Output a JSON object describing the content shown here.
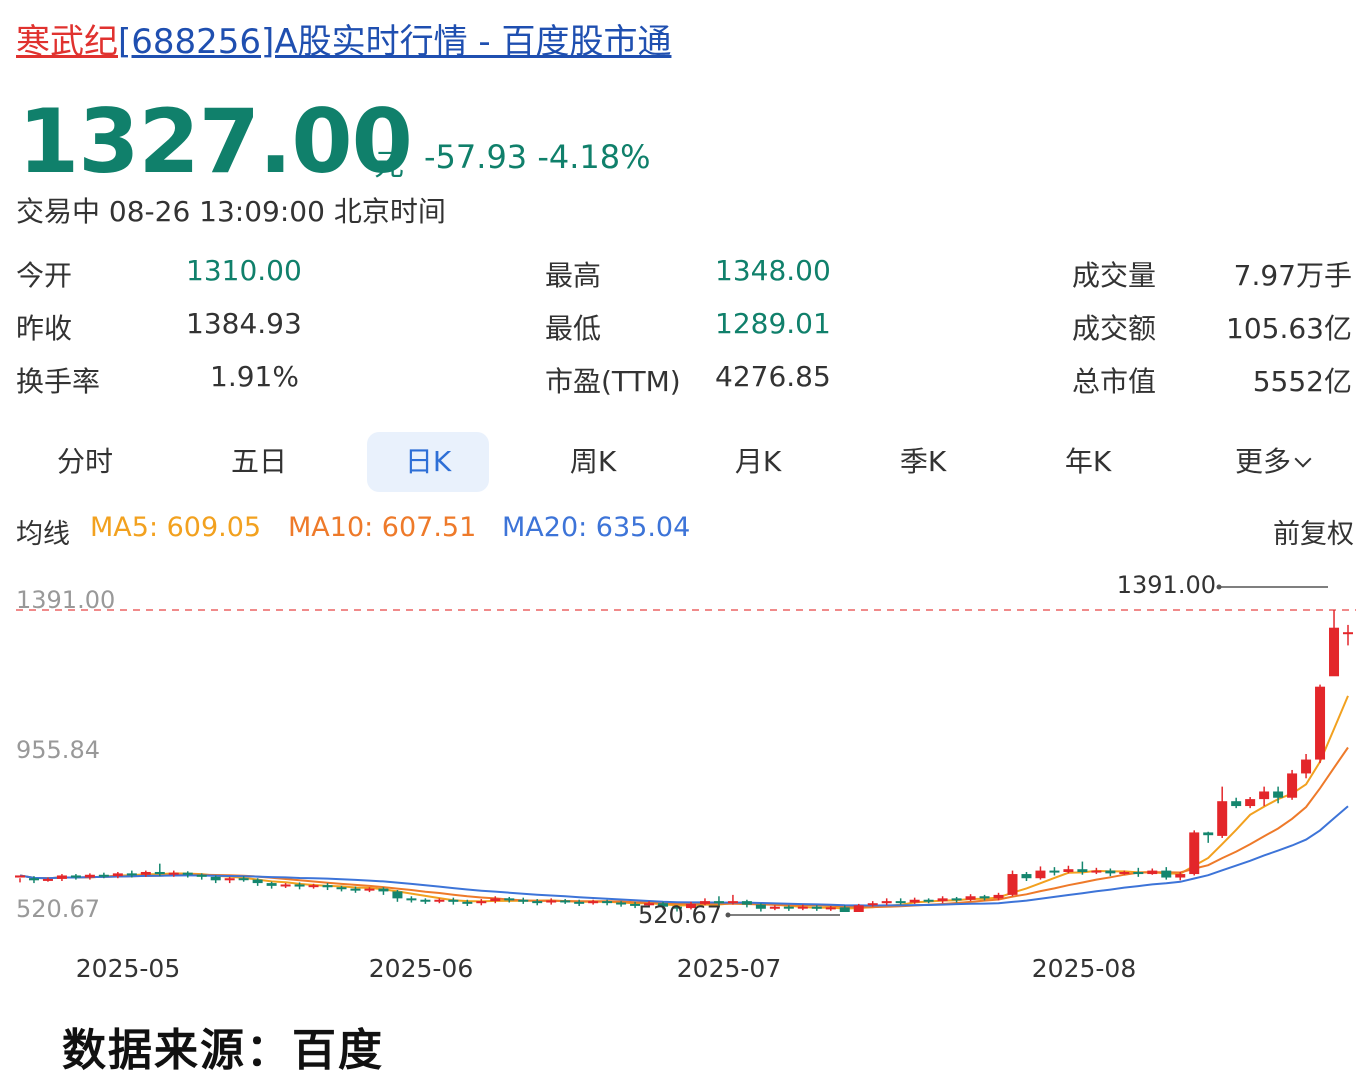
{
  "header": {
    "stock_name": "寒武纪",
    "title_rest": "[688256]A股实时行情 - 百度股市通"
  },
  "quote": {
    "price": "1327.00",
    "unit": "元",
    "change": "-57.93",
    "change_pct": "-4.18%",
    "status": "交易中 08-26 13:09:00 北京时间",
    "stats": [
      {
        "label": "今开",
        "value": "1310.00"
      },
      {
        "label": "最高",
        "value": "1348.00"
      },
      {
        "label": "成交量",
        "value": "7.97万手"
      },
      {
        "label": "昨收",
        "value": "1384.93"
      },
      {
        "label": "最低",
        "value": "1289.01"
      },
      {
        "label": "成交额",
        "value": "105.63亿"
      },
      {
        "label": "换手率",
        "value": "1.91%"
      },
      {
        "label": "市盈(TTM)",
        "value": "4276.85"
      },
      {
        "label": "总市值",
        "value": "5552亿"
      }
    ]
  },
  "tabs": [
    {
      "label": "分时"
    },
    {
      "label": "五日"
    },
    {
      "label": "日K",
      "active": true
    },
    {
      "label": "周K"
    },
    {
      "label": "月K"
    },
    {
      "label": "季K"
    },
    {
      "label": "年K"
    },
    {
      "label": "更多"
    }
  ],
  "ma_legend": {
    "label": "均线",
    "ma5": "MA5: 609.05",
    "ma10": "MA10: 607.51",
    "ma20": "MA20: 635.04",
    "adjust": "前复权"
  },
  "colors": {
    "up": "#e3262a",
    "down": "#14866e",
    "ma5": "#f2a11f",
    "ma10": "#ee7a2a",
    "ma20": "#3d74d8",
    "tab_active": "#2e6fd6"
  },
  "chart_data": {
    "type": "candlestick",
    "ylim": [
      520.67,
      1391.0
    ],
    "y_ticks": [
      "1391.00",
      "955.84",
      "520.67"
    ],
    "x_ticks": [
      "2025-05",
      "2025-06",
      "2025-07",
      "2025-08"
    ],
    "high_marker": "1391.00",
    "low_marker": "520.67",
    "candles": [
      [
        620,
        626,
        606,
        618
      ],
      [
        618,
        612,
        604,
        624
      ],
      [
        612,
        616,
        608,
        620
      ],
      [
        616,
        626,
        610,
        630
      ],
      [
        626,
        620,
        614,
        630
      ],
      [
        620,
        628,
        614,
        632
      ],
      [
        628,
        624,
        618,
        634
      ],
      [
        624,
        632,
        618,
        636
      ],
      [
        632,
        628,
        620,
        640
      ],
      [
        628,
        636,
        622,
        640
      ],
      [
        636,
        630,
        624,
        660
      ],
      [
        630,
        634,
        622,
        640
      ],
      [
        634,
        628,
        620,
        638
      ],
      [
        628,
        622,
        614,
        632
      ],
      [
        622,
        612,
        604,
        626
      ],
      [
        612,
        618,
        604,
        622
      ],
      [
        618,
        614,
        608,
        624
      ],
      [
        614,
        604,
        596,
        618
      ],
      [
        604,
        596,
        588,
        608
      ],
      [
        596,
        600,
        590,
        604
      ],
      [
        600,
        594,
        586,
        606
      ],
      [
        594,
        598,
        588,
        602
      ],
      [
        598,
        592,
        584,
        604
      ],
      [
        592,
        588,
        580,
        596
      ],
      [
        588,
        584,
        576,
        594
      ],
      [
        584,
        588,
        578,
        592
      ],
      [
        588,
        580,
        570,
        592
      ],
      [
        580,
        560,
        550,
        584
      ],
      [
        560,
        556,
        548,
        566
      ],
      [
        556,
        552,
        544,
        560
      ],
      [
        552,
        556,
        546,
        560
      ],
      [
        556,
        550,
        542,
        562
      ],
      [
        550,
        546,
        538,
        556
      ],
      [
        546,
        552,
        540,
        558
      ],
      [
        552,
        560,
        546,
        566
      ],
      [
        560,
        556,
        548,
        564
      ],
      [
        556,
        552,
        544,
        562
      ],
      [
        552,
        548,
        540,
        558
      ],
      [
        548,
        554,
        542,
        560
      ],
      [
        554,
        550,
        544,
        558
      ],
      [
        550,
        546,
        538,
        556
      ],
      [
        546,
        552,
        542,
        556
      ],
      [
        552,
        548,
        540,
        556
      ],
      [
        548,
        544,
        536,
        552
      ],
      [
        544,
        540,
        532,
        550
      ],
      [
        540,
        546,
        534,
        552
      ],
      [
        546,
        536,
        528,
        550
      ],
      [
        536,
        532,
        522,
        540
      ],
      [
        532,
        544,
        528,
        550
      ],
      [
        544,
        552,
        540,
        560
      ],
      [
        552,
        548,
        540,
        566
      ],
      [
        548,
        552,
        542,
        570
      ],
      [
        552,
        542,
        534,
        556
      ],
      [
        542,
        530,
        522,
        546
      ],
      [
        530,
        536,
        526,
        540
      ],
      [
        536,
        532,
        524,
        540
      ],
      [
        532,
        536,
        526,
        542
      ],
      [
        536,
        530,
        524,
        540
      ],
      [
        530,
        534,
        524,
        538
      ],
      [
        534,
        520.67,
        520.67,
        540
      ],
      [
        520.67,
        540,
        520.67,
        544
      ],
      [
        540,
        546,
        536,
        552
      ],
      [
        546,
        552,
        540,
        560
      ],
      [
        552,
        548,
        542,
        560
      ],
      [
        548,
        556,
        544,
        562
      ],
      [
        556,
        552,
        546,
        560
      ],
      [
        552,
        560,
        546,
        566
      ],
      [
        560,
        556,
        548,
        564
      ],
      [
        556,
        566,
        552,
        572
      ],
      [
        566,
        560,
        554,
        570
      ],
      [
        560,
        570,
        554,
        576
      ],
      [
        570,
        630,
        566,
        640
      ],
      [
        630,
        618,
        610,
        636
      ],
      [
        618,
        640,
        614,
        652
      ],
      [
        640,
        636,
        626,
        650
      ],
      [
        636,
        644,
        632,
        654
      ],
      [
        644,
        636,
        628,
        666
      ],
      [
        636,
        640,
        630,
        648
      ],
      [
        640,
        632,
        624,
        646
      ],
      [
        632,
        636,
        628,
        640
      ],
      [
        636,
        630,
        622,
        648
      ],
      [
        630,
        640,
        628,
        646
      ],
      [
        640,
        620,
        614,
        650
      ],
      [
        620,
        630,
        612,
        636
      ],
      [
        630,
        750,
        626,
        756
      ],
      [
        750,
        742,
        720,
        752
      ],
      [
        740,
        840,
        734,
        882
      ],
      [
        840,
        826,
        820,
        850
      ],
      [
        826,
        846,
        820,
        852
      ],
      [
        846,
        868,
        826,
        882
      ],
      [
        868,
        850,
        834,
        882
      ],
      [
        850,
        920,
        844,
        930
      ],
      [
        920,
        960,
        906,
        976
      ],
      [
        960,
        1170,
        950,
        1176
      ],
      [
        1200,
        1340,
        1280,
        1391
      ],
      [
        1326,
        1327,
        1289,
        1348
      ]
    ]
  }
}
